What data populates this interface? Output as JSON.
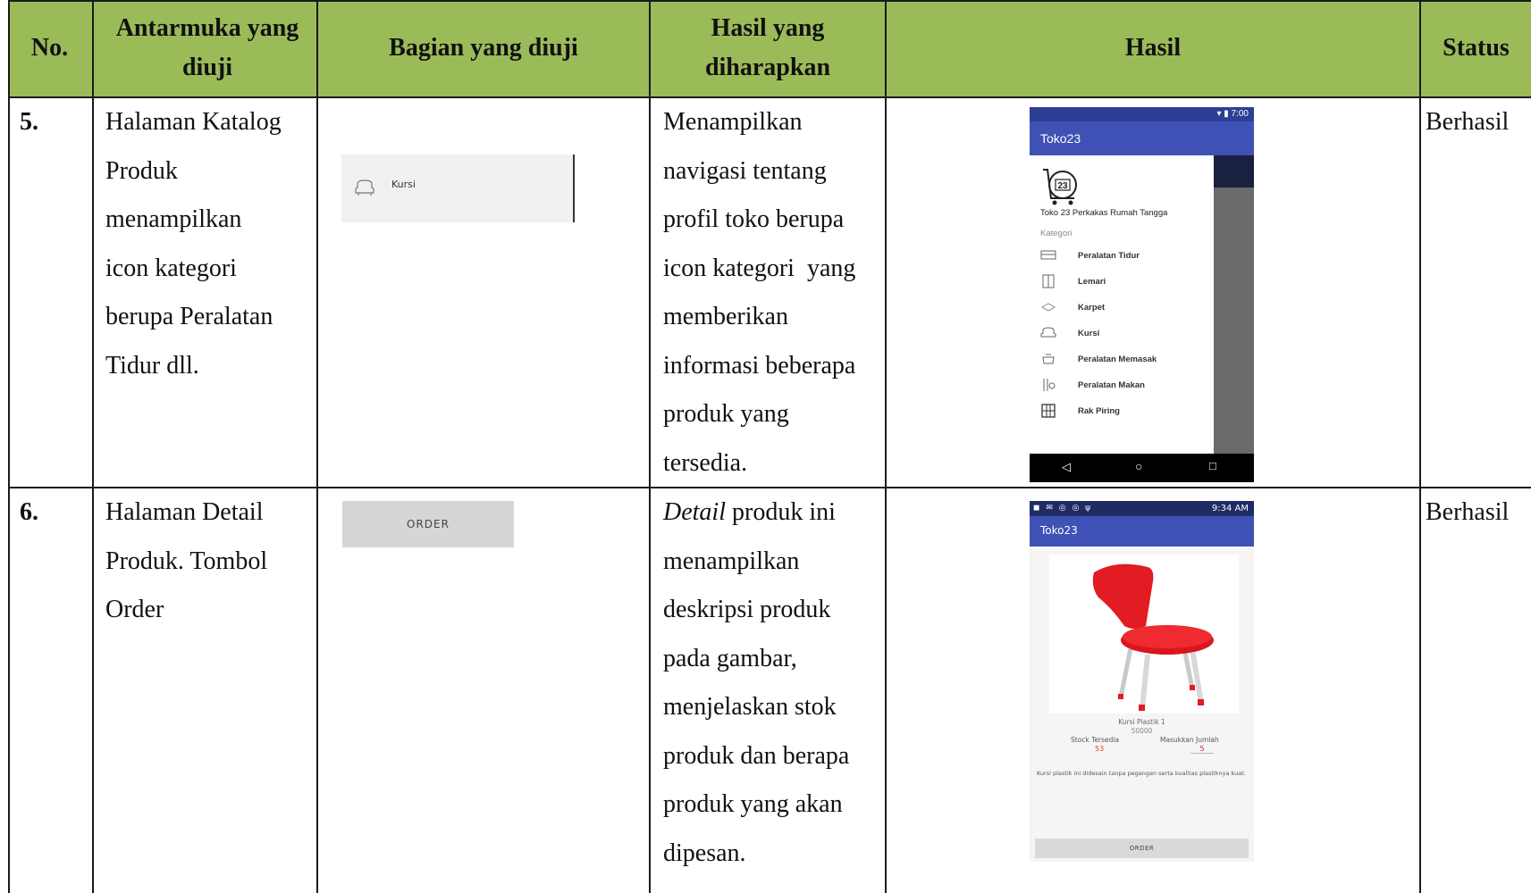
{
  "table": {
    "headers": {
      "no": "No.",
      "interface": "Antarmuka yang diuji",
      "section": "Bagian yang diuji",
      "expected": "Hasil yang diharapkan",
      "result": "Hasil",
      "status": "Status"
    },
    "rows": [
      {
        "no": "5.",
        "interface_lines": [
          "Halaman Katalog",
          "Produk",
          "menampilkan",
          "icon kategori",
          "berupa Peralatan",
          "Tidur dll."
        ],
        "section_image_label": "Kursi",
        "expected_lines": [
          "Menampilkan",
          "navigasi tentang",
          "profil toko berupa",
          "icon kategori  yang",
          "memberikan",
          "informasi beberapa",
          "produk yang",
          "tersedia."
        ],
        "status": "Berhasil"
      },
      {
        "no": "6.",
        "interface_lines": [
          "Halaman Detail",
          "Produk. Tombol",
          "Order"
        ],
        "section_image_label": "ORDER",
        "expected_first_italic": "Detail",
        "expected_first_rest": " produk ini",
        "expected_lines": [
          "menampilkan",
          "deskripsi produk",
          "pada gambar,",
          "menjelaskan stok",
          "produk dan berapa",
          "produk yang akan",
          "dipesan."
        ],
        "status": "Berhasil"
      }
    ]
  },
  "phone1": {
    "status_time": "7:00",
    "app_title": "Toko23",
    "logo_text": "23",
    "store_name": "Toko 23 Perkakas Rumah Tangga",
    "category_header": "Kategori",
    "categories": [
      {
        "label": "Peralatan Tidur",
        "icon": "bed-icon"
      },
      {
        "label": "Lemari",
        "icon": "wardrobe-icon"
      },
      {
        "label": "Karpet",
        "icon": "carpet-icon"
      },
      {
        "label": "Kursi",
        "icon": "chair-icon"
      },
      {
        "label": "Peralatan Memasak",
        "icon": "pot-icon"
      },
      {
        "label": "Peralatan Makan",
        "icon": "cutlery-icon"
      },
      {
        "label": "Rak Piring",
        "icon": "rack-icon"
      }
    ],
    "nav": {
      "back": "◁",
      "home": "○",
      "recent": "□"
    }
  },
  "phone2": {
    "status_text": "9:34 AM",
    "app_title": "Toko23",
    "product_name": "Kursi Plastik 1",
    "price": "50000",
    "stock_label": "Stock Tersedia",
    "stock_value": "53",
    "qty_label": "Masukkan Jumlah",
    "qty_value": "5",
    "description": "Kursi plastik ini didesain tanpa pegangan serta kualitas plastiknya kuat.",
    "order_button": "ORDER",
    "colors": {
      "chair": "#e31b23",
      "appbar": "#3f51b5"
    }
  },
  "colors": {
    "header_bg": "#9bbb59",
    "grid": "#1a1a1a"
  }
}
